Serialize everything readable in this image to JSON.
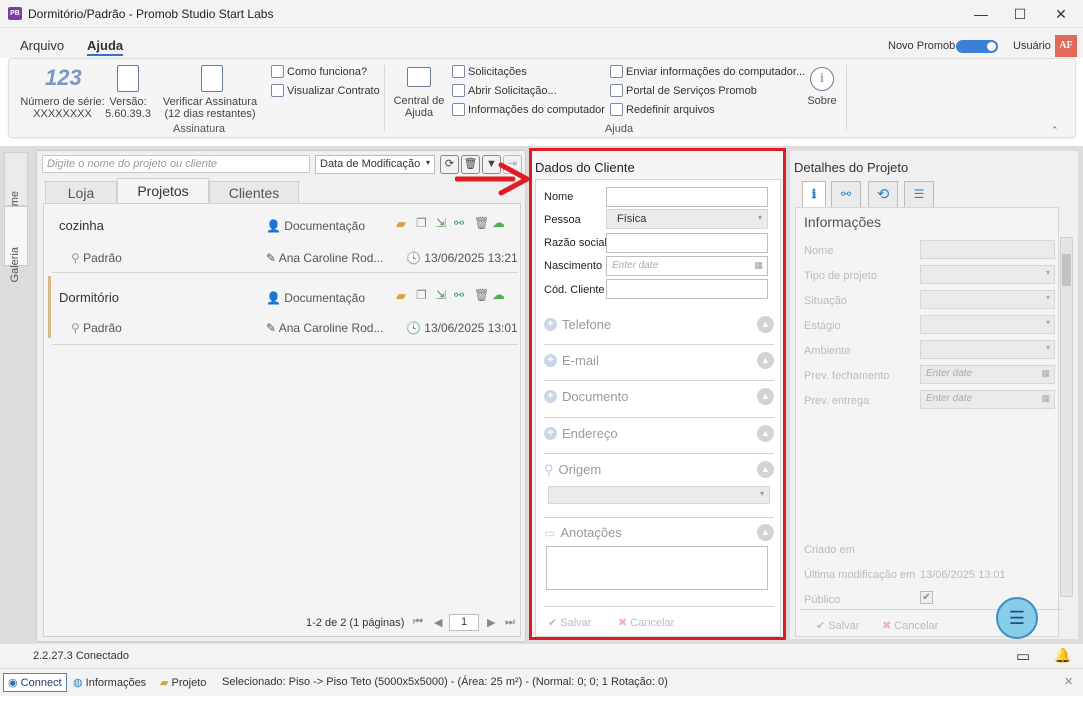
{
  "window": {
    "title": "Dormitório/Padrão - Promob Studio Start Labs",
    "app_badge": "PB"
  },
  "menu": {
    "items": [
      "Arquivo",
      "Ajuda"
    ],
    "active": "Ajuda",
    "novo_promob_label": "Novo Promob",
    "novo_promob_on": true,
    "user_label": "Usuário",
    "user_initials": "AF"
  },
  "ribbon": {
    "serial_label": "Número de série:",
    "serial_value": "XXXXXXXX",
    "version_label": "Versão:",
    "version_value": "5.60.39.3",
    "verify_label": "Verificar Assinatura (12 dias restantes)",
    "como_funciona": "Como funciona?",
    "visualizar_contrato": "Visualizar Contrato",
    "group_assinatura": "Assinatura",
    "central_ajuda": "Central de Ajuda",
    "solicitacoes": "Solicitações",
    "abrir_solicitacao": "Abrir Solicitação...",
    "info_computador": "Informações do computador",
    "enviar_info": "Enviar informações do computador...",
    "portal_servicos": "Portal de Serviços Promob",
    "redefinir_arquivos": "Redefinir arquivos",
    "sobre": "Sobre",
    "group_ajuda": "Ajuda"
  },
  "sidebar_tabs": [
    "Home",
    "Galeria"
  ],
  "projects": {
    "search_placeholder": "Digite o nome do projeto ou cliente",
    "sort_value": "Data de Modificação",
    "tabs": [
      "Loja",
      "Projetos",
      "Clientes"
    ],
    "active_tab": "Projetos",
    "rows": [
      {
        "name": "cozinha",
        "doc": "Documentação",
        "variant": "Padrão",
        "author": "Ana Caroline Rod...",
        "date": "13/06/2025 13:21"
      },
      {
        "name": "Dormitório",
        "doc": "Documentação",
        "variant": "Padrão",
        "author": "Ana Caroline Rod...",
        "date": "13/06/2025 13:01"
      }
    ],
    "pagination": "1-2 de 2 (1 páginas)",
    "page": "1"
  },
  "client": {
    "title": "Dados do Cliente",
    "nome_label": "Nome",
    "pessoa_label": "Pessoa",
    "pessoa_value": "Física",
    "razao_label": "Razão social",
    "nascimento_label": "Nascimento",
    "date_placeholder": "Enter date",
    "cod_label": "Cód. Cliente",
    "sections": [
      "Telefone",
      "E-mail",
      "Documento",
      "Endereço",
      "Origem",
      "Anotações"
    ],
    "save": "Salvar",
    "cancel": "Cancelar"
  },
  "details": {
    "title": "Detalhes do Projeto",
    "info_title": "Informações",
    "fields": [
      "Nome",
      "Tipo de projeto",
      "Situação",
      "Estágio",
      "Ambiente",
      "Prev. fechamento",
      "Prev. entrega"
    ],
    "date_placeholder": "Enter date",
    "criado_em": "Criado em",
    "ultima_mod_label": "Última modificação em",
    "ultima_mod_value": "13/06/2025 13:01",
    "publico": "Público",
    "save": "Salvar",
    "cancel": "Cancelar"
  },
  "status": {
    "connection": "2.2.27.3 Conectado",
    "connect": "Connect",
    "informacoes": "Informações",
    "projeto": "Projeto",
    "selection": "Selecionado: Piso -> Piso Teto (5000x5x5000) - (Área: 25 m²) - (Normal: 0; 0; 1 Rotação: 0)"
  },
  "colors": {
    "accent": "#3b7fd6",
    "highlight": "#e01b24",
    "project_marker": "#d9b98a"
  }
}
